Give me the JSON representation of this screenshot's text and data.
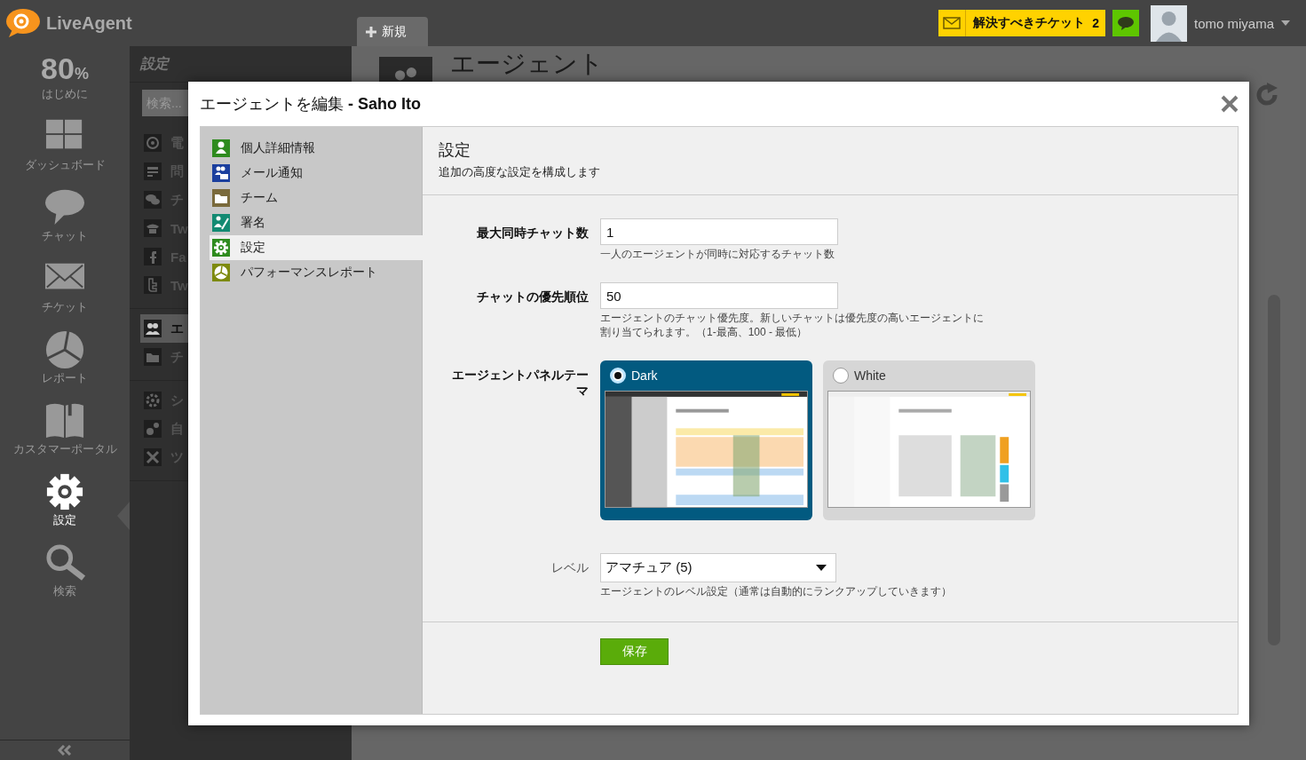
{
  "top_bar": {
    "logo": "LiveAgent",
    "new_tab": "新規",
    "tickets_button": {
      "label": "解決すべきチケット",
      "count": "2"
    },
    "user": "tomo miyama"
  },
  "nav": {
    "progress": "80",
    "progress_unit": "%",
    "progress_label": "はじめに",
    "items": [
      {
        "kind": "dashboard",
        "label": "ダッシュボード",
        "selected": false
      },
      {
        "kind": "chat",
        "label": "チャット",
        "selected": false
      },
      {
        "kind": "ticket",
        "label": "チケット",
        "selected": false
      },
      {
        "kind": "report",
        "label": "レポート",
        "selected": false
      },
      {
        "kind": "portal",
        "label": "カスタマーポータル",
        "selected": false
      },
      {
        "kind": "settings",
        "label": "設定",
        "selected": true
      },
      {
        "kind": "search",
        "label": "検索",
        "selected": false
      }
    ]
  },
  "settings_panel": {
    "title": "設定",
    "search_placeholder": "検索...",
    "sections": [
      {
        "items": [
          {
            "kind": "email",
            "label": "電",
            "selected": false
          },
          {
            "kind": "form",
            "label": "問",
            "selected": false
          },
          {
            "kind": "chat",
            "label": "チ",
            "selected": false
          },
          {
            "kind": "phone",
            "label": "Tw",
            "selected": false
          },
          {
            "kind": "facebook",
            "label": "Fa",
            "selected": false
          },
          {
            "kind": "twitter",
            "label": "Tw",
            "selected": false
          }
        ]
      },
      {
        "items": [
          {
            "kind": "agents",
            "label": "エ",
            "selected": true
          },
          {
            "kind": "teams",
            "label": "チ",
            "selected": false
          }
        ]
      },
      {
        "items": [
          {
            "kind": "system",
            "label": "シ",
            "selected": false
          },
          {
            "kind": "automation",
            "label": "自",
            "selected": false
          },
          {
            "kind": "tools",
            "label": "ツ",
            "selected": false
          }
        ]
      }
    ]
  },
  "main": {
    "title": "エージェント"
  },
  "dialog": {
    "title": "エージェントを編集 **- Saho Ito**",
    "menu": [
      {
        "kind": "person",
        "label": "個人詳細情報",
        "color": "#2e8b1e",
        "selected": false
      },
      {
        "kind": "mail",
        "label": "メール通知",
        "color": "#1b3f9e",
        "selected": false
      },
      {
        "kind": "team",
        "label": "チーム",
        "color": "#7a6a3c",
        "selected": false
      },
      {
        "kind": "signature",
        "label": "署名",
        "color": "#138a72",
        "selected": false
      },
      {
        "kind": "settings",
        "label": "設定",
        "color": "#2e8b1e",
        "selected": true
      },
      {
        "kind": "report",
        "label": "パフォーマンスレポート",
        "color": "#7d8a0e",
        "selected": false
      }
    ],
    "section_title": "設定",
    "section_subtitle": "追加の高度な設定を構成します",
    "fields": [
      {
        "kind": "text",
        "label": "最大同時チャット数",
        "value": "1",
        "hint": "一人のエージェントが同時に対応するチャット数"
      },
      {
        "kind": "text",
        "label": "チャットの優先順位",
        "value": "50",
        "hint": "エージェントのチャット優先度。新しいチャットは優先度の高いエージェントに割り当てられます。（1-最高、100 - 最低）"
      },
      {
        "kind": "theme",
        "label": "エージェントパネルテーマ",
        "options": [
          {
            "kind": "dark",
            "label": "Dark",
            "selected": true
          },
          {
            "kind": "light",
            "label": "White",
            "selected": false
          }
        ]
      },
      {
        "kind": "select",
        "label": "レベル",
        "value": "アマチュア (5)",
        "hint": "エージェントのレベル設定（通常は自動的にランクアップしていきます）"
      }
    ],
    "save_button": "保存"
  }
}
